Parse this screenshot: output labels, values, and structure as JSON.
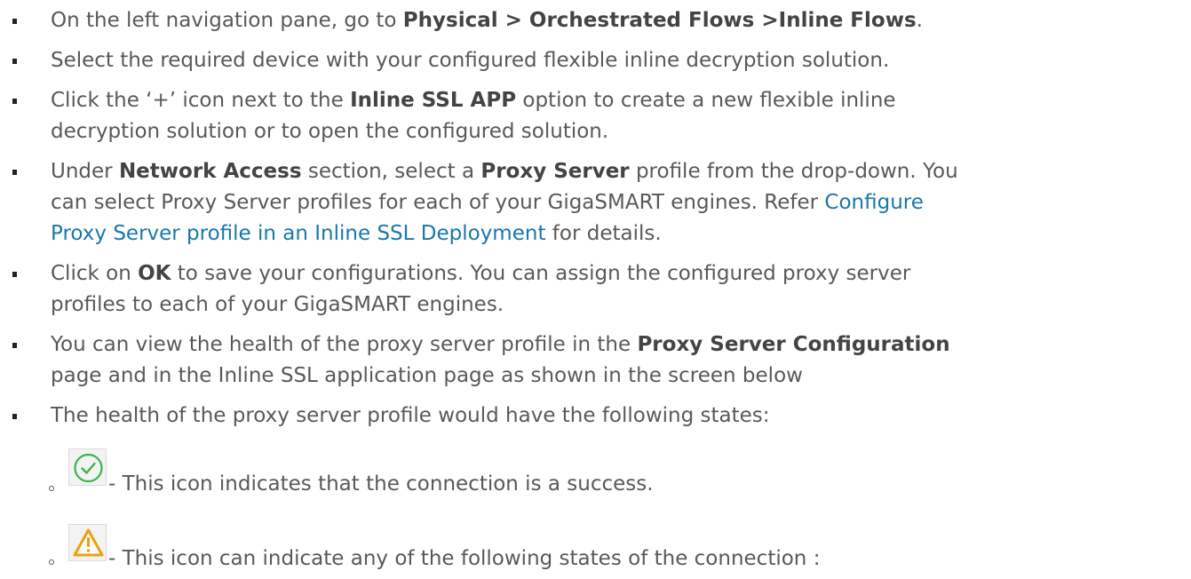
{
  "steps": {
    "s1": {
      "pre": "On the left navigation pane, go to ",
      "bold": "Physical > Orchestrated Flows >Inline Flows",
      "post": "."
    },
    "s2": {
      "text": "Select the required device with your configured flexible inline decryption solution."
    },
    "s3": {
      "pre": "Click the ‘+’ icon next to the ",
      "bold": "Inline SSL APP",
      "post_line1": " option to create a new flexible inline",
      "line2": "decryption solution or to open the configured solution."
    },
    "s4": {
      "pre": "Under ",
      "bold1": "Network Access",
      "mid1": " section, select a ",
      "bold2": "Proxy Server",
      "post_line1": " profile from the drop-down. You",
      "line2_pre": "can select Proxy Server profiles for each of your GigaSMART engines. Refer ",
      "link_line2": "Configure",
      "link_line3": "Proxy Server profile in an Inline SSL Deployment",
      "line3_post": " for details."
    },
    "s5": {
      "pre": "Click on ",
      "bold": "OK",
      "post_line1": " to save your configurations. You can assign the configured proxy server",
      "line2": "profiles to each of your GigaSMART engines."
    },
    "s6": {
      "pre": "You can view the health of the proxy server profile in the ",
      "bold": "Proxy Server Configuration",
      "line2": "page and in the Inline SSL application page as shown in the screen below"
    },
    "s7": {
      "text": "The health of the proxy server profile would have the following states:"
    }
  },
  "states": [
    {
      "icon": "success-check-icon",
      "text": "- This icon indicates that the connection is a success."
    },
    {
      "icon": "warning-triangle-icon",
      "text": "- This icon can indicate any of the following states of the connection :"
    }
  ],
  "colors": {
    "text": "#595959",
    "link": "#1a78a8",
    "success": "#3cb44a",
    "warning": "#f39c12"
  }
}
